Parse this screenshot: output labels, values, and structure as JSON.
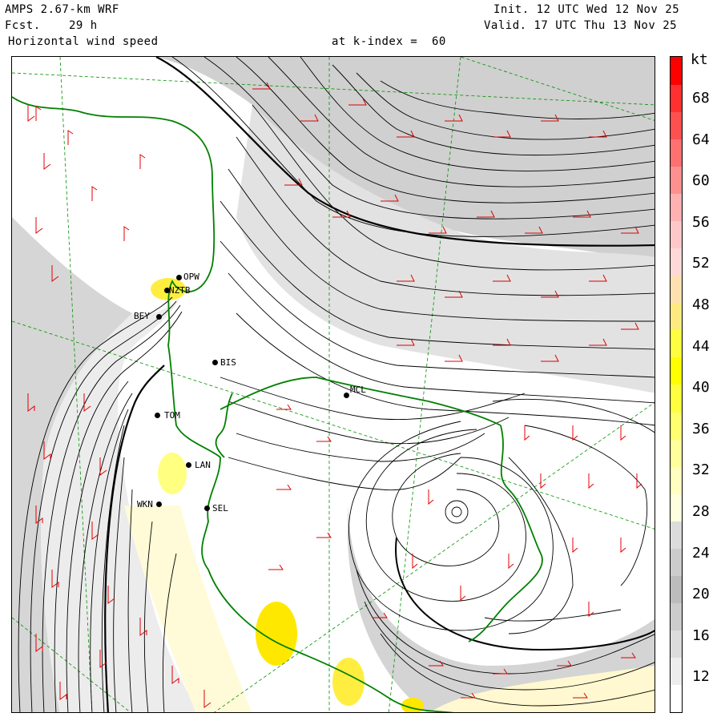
{
  "header": {
    "model": "AMPS 2.67-km WRF",
    "forecast_label": "Fcst.",
    "forecast_value": "29 h",
    "field": "Horizontal wind speed",
    "init": "Init. 12 UTC Wed 12 Nov 25",
    "valid": "Valid. 17 UTC Thu 13 Nov 25",
    "kindex": "at k-index =  60"
  },
  "colorbar": {
    "unit": "kt",
    "ticks": [
      "68",
      "64",
      "60",
      "56",
      "52",
      "48",
      "44",
      "40",
      "36",
      "32",
      "28",
      "24",
      "20",
      "16",
      "12"
    ],
    "levels": [
      {
        "color": "#ffffff"
      },
      {
        "color": "#ededed"
      },
      {
        "color": "#dcdcdc"
      },
      {
        "color": "#cccccc"
      },
      {
        "color": "#bcbcbc"
      },
      {
        "color": "#cccccc"
      },
      {
        "color": "#dcdcdc"
      },
      {
        "color": "#ffffe0"
      },
      {
        "color": "#ffffc0"
      },
      {
        "color": "#ffff9c"
      },
      {
        "color": "#ffff70"
      },
      {
        "color": "#ffff40"
      },
      {
        "color": "#ffff00"
      },
      {
        "color": "#ffff40"
      },
      {
        "color": "#ffea80"
      },
      {
        "color": "#ffe0b0"
      },
      {
        "color": "#ffd8d8"
      },
      {
        "color": "#ffc8c8"
      },
      {
        "color": "#ffb0b0"
      },
      {
        "color": "#ff9090"
      },
      {
        "color": "#ff7070"
      },
      {
        "color": "#ff5050"
      },
      {
        "color": "#ff3030"
      },
      {
        "color": "#ff0000"
      }
    ]
  },
  "stations": [
    {
      "id": "OPW"
    },
    {
      "id": "NZTB"
    },
    {
      "id": "BEY"
    },
    {
      "id": "BIS"
    },
    {
      "id": "MCL"
    },
    {
      "id": "TOM"
    },
    {
      "id": "LAN"
    },
    {
      "id": "WKN"
    },
    {
      "id": "SEL"
    }
  ]
}
